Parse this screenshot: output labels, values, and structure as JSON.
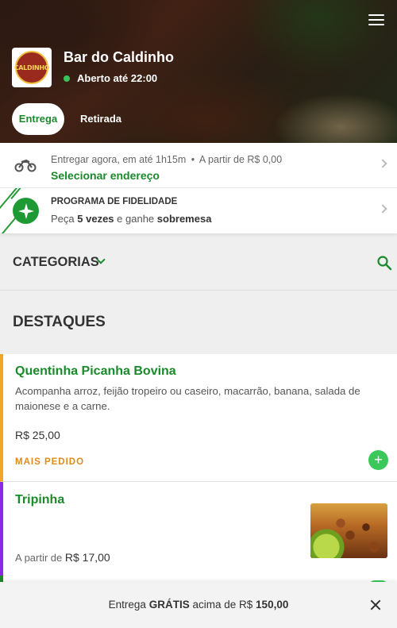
{
  "store": {
    "name": "Bar do Caldinho",
    "status": "Aberto até 22:00",
    "logo_text": "CALDINHO"
  },
  "tabs": [
    {
      "label": "Entrega",
      "active": true
    },
    {
      "label": "Retirada",
      "active": false
    }
  ],
  "delivery": {
    "eta": "Entregar agora, em até 1h15m",
    "separator": "•",
    "min_order": "A partir de R$ 0,00",
    "action": "Selecionar endereço",
    "icon": "motorcycle-icon"
  },
  "loyalty": {
    "title": "PROGRAMA DE FIDELIDADE",
    "text_prefix": "Peça",
    "times": "5 vezes",
    "text_middle": "e ganhe",
    "reward": "sobremesa",
    "icon": "star-badge-icon"
  },
  "categories": {
    "label": "CATEGORIAS",
    "search_icon": "search-icon"
  },
  "section_title": "DESTAQUES",
  "products": [
    {
      "name": "Quentinha Picanha Bovina",
      "description": "Acompanha arroz, feijão tropeiro ou caseiro, macarrão, banana, salada de maionese e a carne.",
      "price": "R$ 25,00",
      "tag": "MAIS PEDIDO",
      "accent": "#f0a62a"
    },
    {
      "name": "Tripinha",
      "price_prefix": "A partir de",
      "price": "R$ 17,00",
      "accent": "#8a2be2"
    }
  ],
  "footer": {
    "prefix": "Entrega",
    "highlight": "GRÁTIS",
    "middle": "acima de R$",
    "amount": "150,00"
  },
  "colors": {
    "primary": "#1a8a2a",
    "add_button": "#3bc85a",
    "open_dot": "#39c35a"
  }
}
